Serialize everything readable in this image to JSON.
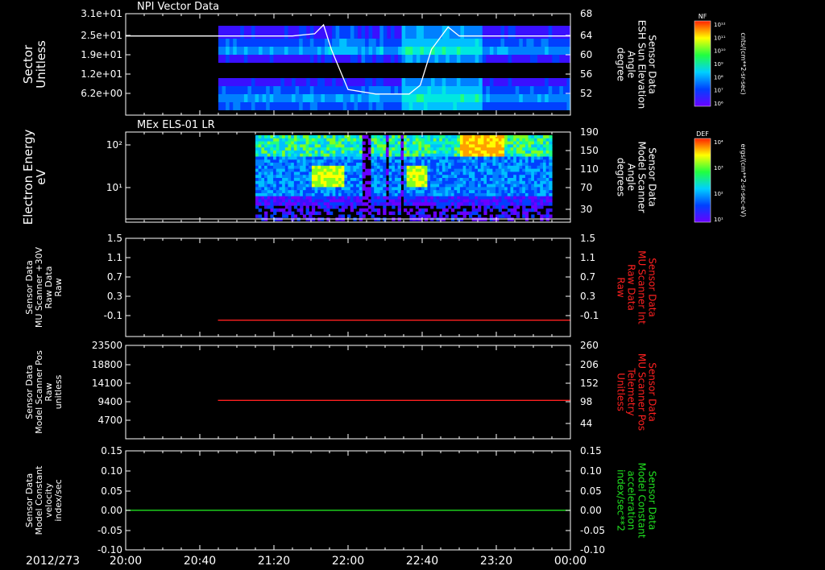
{
  "date_label": "2012/273",
  "time_ticks": [
    "20:00",
    "20:40",
    "21:20",
    "22:00",
    "22:40",
    "23:20",
    "00:00"
  ],
  "panels": [
    {
      "title": "NPI Vector Data",
      "left_label": [
        "Sector",
        "Unitless"
      ],
      "left_ticks": [
        "3.1e+01",
        "2.5e+01",
        "1.9e+01",
        "1.2e+01",
        "6.2e+00"
      ],
      "right_ticks": [
        "68",
        "64",
        "60",
        "56",
        "52"
      ],
      "right_label": [
        "Sensor Data",
        "ESH Sun Elevation",
        "Angle",
        "degree"
      ],
      "right_label_color": "#ffffff"
    },
    {
      "title": "MEx ELS-01 LR",
      "left_label": [
        "Electron Energy",
        "eV"
      ],
      "left_ticks": [
        "10²",
        "10¹"
      ],
      "right_ticks": [
        "190",
        "150",
        "110",
        "70",
        "30"
      ],
      "right_label": [
        "Sensor Data",
        "Model Scanner",
        "Angle",
        "degrees"
      ],
      "right_label_color": "#ffffff"
    },
    {
      "title": "",
      "left_label": [
        "Sensor Data",
        "MU Scanner +30V",
        "Raw Data",
        "Raw"
      ],
      "left_ticks": [
        "1.5",
        "1.1",
        "0.7",
        "0.3",
        "-0.1"
      ],
      "right_ticks": [
        "1.5",
        "1.1",
        "0.7",
        "0.3",
        "-0.1"
      ],
      "right_label": [
        "Sensor Data",
        "MU Scanner Int",
        "Raw Data",
        "Raw"
      ],
      "right_label_color": "#ff2020"
    },
    {
      "title": "",
      "left_label": [
        "Sensor Data",
        "Model Scanner Pos",
        "Raw",
        "unitless"
      ],
      "left_ticks": [
        "23500",
        "18800",
        "14100",
        "9400",
        "4700"
      ],
      "right_ticks": [
        "260",
        "206",
        "152",
        "98",
        "44"
      ],
      "right_label": [
        "Sensor Data",
        "MU Scanner Pos",
        "Telemetry",
        "Unitless"
      ],
      "right_label_color": "#ff2020"
    },
    {
      "title": "",
      "left_label": [
        "Sensor Data",
        "Model Constant",
        "velocity",
        "index/sec"
      ],
      "left_ticks": [
        "0.15",
        "0.10",
        "0.05",
        "0.00",
        "-0.05",
        "-0.10"
      ],
      "right_ticks": [
        "0.15",
        "0.10",
        "0.05",
        "0.00",
        "-0.05",
        "-0.10"
      ],
      "right_label": [
        "Sensor Data",
        "Model Constant",
        "acceleration",
        "index/sec**2"
      ],
      "right_label_color": "#20e020"
    }
  ],
  "colorbars": [
    {
      "label": "NF",
      "units": "cnts/(cm**2-sr-sec)",
      "ticks": [
        "10¹²",
        "10¹¹",
        "10¹⁰",
        "10⁹",
        "10⁸",
        "10⁷",
        "10⁶"
      ]
    },
    {
      "label": "DEF",
      "units": "ergs/(cm**2-sr-sec-eV)",
      "ticks": [
        "10⁴",
        "10³",
        "10²",
        "10¹"
      ]
    }
  ],
  "chart_data": [
    {
      "type": "heatmap",
      "title": "NPI Vector Data",
      "xlabel": "",
      "ylabel": "Sector Unitless",
      "y2label": "Sensor Data ESH Sun Elevation Angle degree",
      "x_range": [
        "20:00",
        "00:00"
      ],
      "data_start": "20:50",
      "ylim": [
        0,
        31
      ],
      "y2lim": [
        48,
        68
      ],
      "series": [
        {
          "name": "Sensor Data ESH Sun Elevation Angle",
          "x_hours": [
            20.0,
            21.0,
            21.5,
            21.7,
            21.78,
            21.85,
            22.0,
            22.25,
            22.55,
            22.65,
            22.75,
            22.9,
            23.0,
            23.5,
            24.0
          ],
          "values": [
            63,
            63,
            63,
            63.5,
            65.5,
            60,
            51,
            50,
            50,
            52,
            60,
            65,
            63,
            63,
            63
          ]
        }
      ]
    },
    {
      "type": "heatmap",
      "title": "MEx ELS-01 LR",
      "ylabel": "Electron Energy eV",
      "y2label": "Sensor Data Model Scanner Angle degrees",
      "x_range": [
        "20:00",
        "00:00"
      ],
      "data_range": [
        "21:10",
        "23:50"
      ],
      "ylog": true,
      "y2lim": [
        10,
        190
      ]
    },
    {
      "type": "line",
      "ylabel": "Sensor Data MU Scanner +30V Raw Data Raw",
      "ylim": [
        -0.3,
        1.5
      ],
      "series": [
        {
          "name": "Sensor Data MU Scanner Int Raw Data Raw",
          "x_hours": [
            20.83,
            24.0
          ],
          "values": [
            0.0,
            0.0
          ],
          "color": "#ff2020"
        }
      ]
    },
    {
      "type": "line",
      "ylabel": "Sensor Data Model Scanner Pos Raw unitless",
      "ylim": [
        0,
        23500
      ],
      "y2lim": [
        0,
        260
      ],
      "series": [
        {
          "name": "Sensor Data MU Scanner Pos Telemetry Unitless",
          "x_hours": [
            20.83,
            24.0
          ],
          "values": [
            107,
            107
          ],
          "color": "#ff2020"
        }
      ]
    },
    {
      "type": "line",
      "ylabel": "Sensor Data Model Constant velocity index/sec",
      "ylim": [
        -0.1,
        0.15
      ],
      "series": [
        {
          "name": "Sensor Data Model Constant acceleration index/sec**2",
          "x_hours": [
            20.0,
            24.0
          ],
          "values": [
            0.0,
            0.0
          ],
          "color": "#20e020"
        }
      ]
    }
  ]
}
